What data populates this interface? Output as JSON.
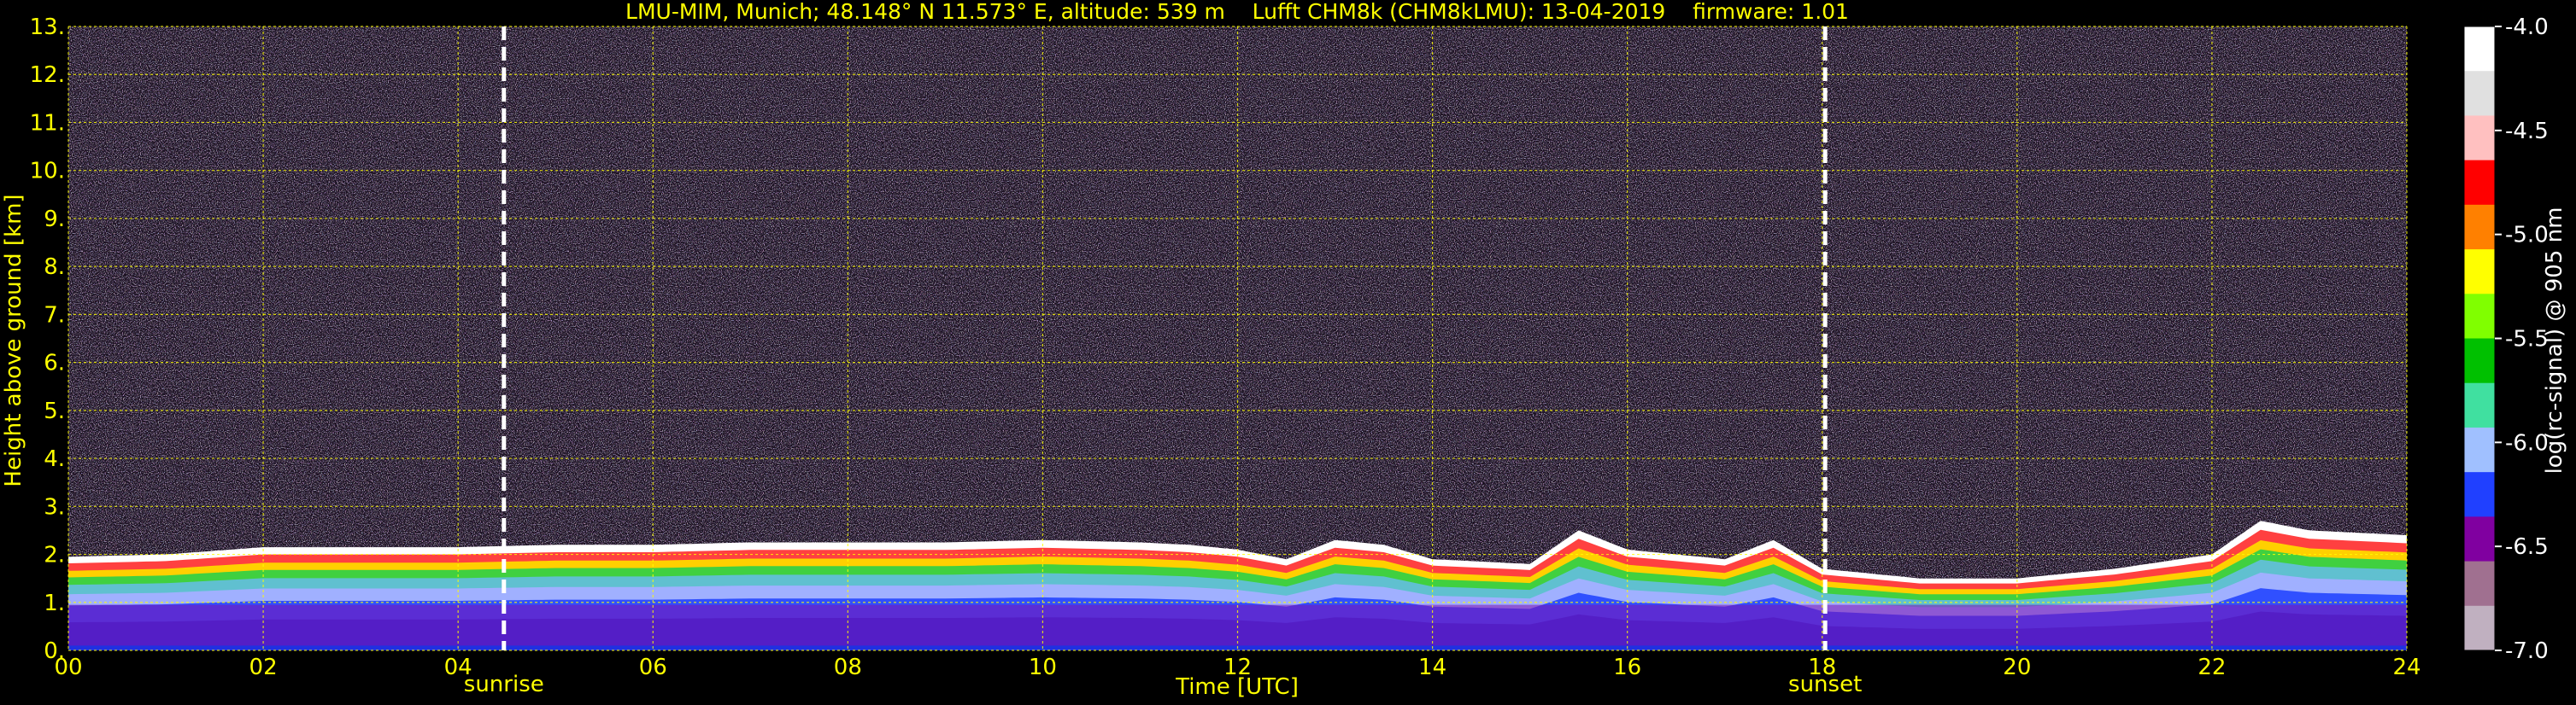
{
  "chart_data": {
    "type": "heatmap",
    "title": "LMU-MIM, Munich; 48.148° N 11.573° E, altitude: 539 m    Lufft CHM8k (CHM8kLMU): 13-04-2019    firmware: 1.01",
    "xlabel": "Time [UTC]",
    "ylabel": "Height above ground [km]",
    "xlim": [
      0,
      24
    ],
    "ylim": [
      0,
      13
    ],
    "xticks": [
      0,
      2,
      4,
      6,
      8,
      10,
      12,
      14,
      16,
      18,
      20,
      22,
      24
    ],
    "xtick_labels": [
      "00",
      "02",
      "04",
      "06",
      "08",
      "10",
      "12",
      "14",
      "16",
      "18",
      "20",
      "22",
      "24"
    ],
    "yticks": [
      0,
      1,
      2,
      3,
      4,
      5,
      6,
      7,
      8,
      9,
      10,
      11,
      12,
      13
    ],
    "ytick_labels": [
      "0.",
      "1.",
      "2.",
      "3.",
      "4.",
      "5.",
      "6.",
      "7.",
      "8.",
      "9.",
      "10.",
      "11.",
      "12.",
      "13."
    ],
    "grid": true,
    "events": [
      {
        "label": "sunrise",
        "time": 4.47
      },
      {
        "label": "sunset",
        "time": 18.03
      }
    ],
    "boundary_layer_top_km": [
      [
        0,
        1.95
      ],
      [
        1,
        2.0
      ],
      [
        2,
        2.15
      ],
      [
        3,
        2.15
      ],
      [
        4,
        2.15
      ],
      [
        5,
        2.2
      ],
      [
        6,
        2.2
      ],
      [
        7,
        2.25
      ],
      [
        8,
        2.25
      ],
      [
        9,
        2.25
      ],
      [
        10,
        2.3
      ],
      [
        11,
        2.25
      ],
      [
        11.5,
        2.2
      ],
      [
        12,
        2.1
      ],
      [
        12.5,
        1.9
      ],
      [
        13,
        2.3
      ],
      [
        13.5,
        2.2
      ],
      [
        14,
        1.9
      ],
      [
        15,
        1.8
      ],
      [
        15.5,
        2.5
      ],
      [
        16,
        2.1
      ],
      [
        17,
        1.9
      ],
      [
        17.5,
        2.3
      ],
      [
        18,
        1.7
      ],
      [
        18.5,
        1.6
      ],
      [
        19,
        1.5
      ],
      [
        20,
        1.5
      ],
      [
        21,
        1.7
      ],
      [
        22,
        2.0
      ],
      [
        22.5,
        2.7
      ],
      [
        23,
        2.5
      ],
      [
        24,
        2.4
      ]
    ],
    "colorbar": {
      "label": "log(rc-signal) @ 905 nm",
      "range": [
        -7.0,
        -4.0
      ],
      "ticks": [
        -4.0,
        -4.5,
        -5.0,
        -5.5,
        -6.0,
        -6.5,
        -7.0
      ],
      "tick_labels": [
        "-4.0",
        "-4.5",
        "-5.0",
        "-5.5",
        "-6.0",
        "-6.5",
        "-7.0"
      ],
      "colors": [
        "#ffffff",
        "#e0e0e0",
        "#ffc0c0",
        "#ff0000",
        "#ff8000",
        "#ffff00",
        "#80ff00",
        "#00c000",
        "#40e0a0",
        "#a0c0ff",
        "#2040ff",
        "#8000a0",
        "#a07090",
        "#c0b0c0"
      ]
    }
  }
}
